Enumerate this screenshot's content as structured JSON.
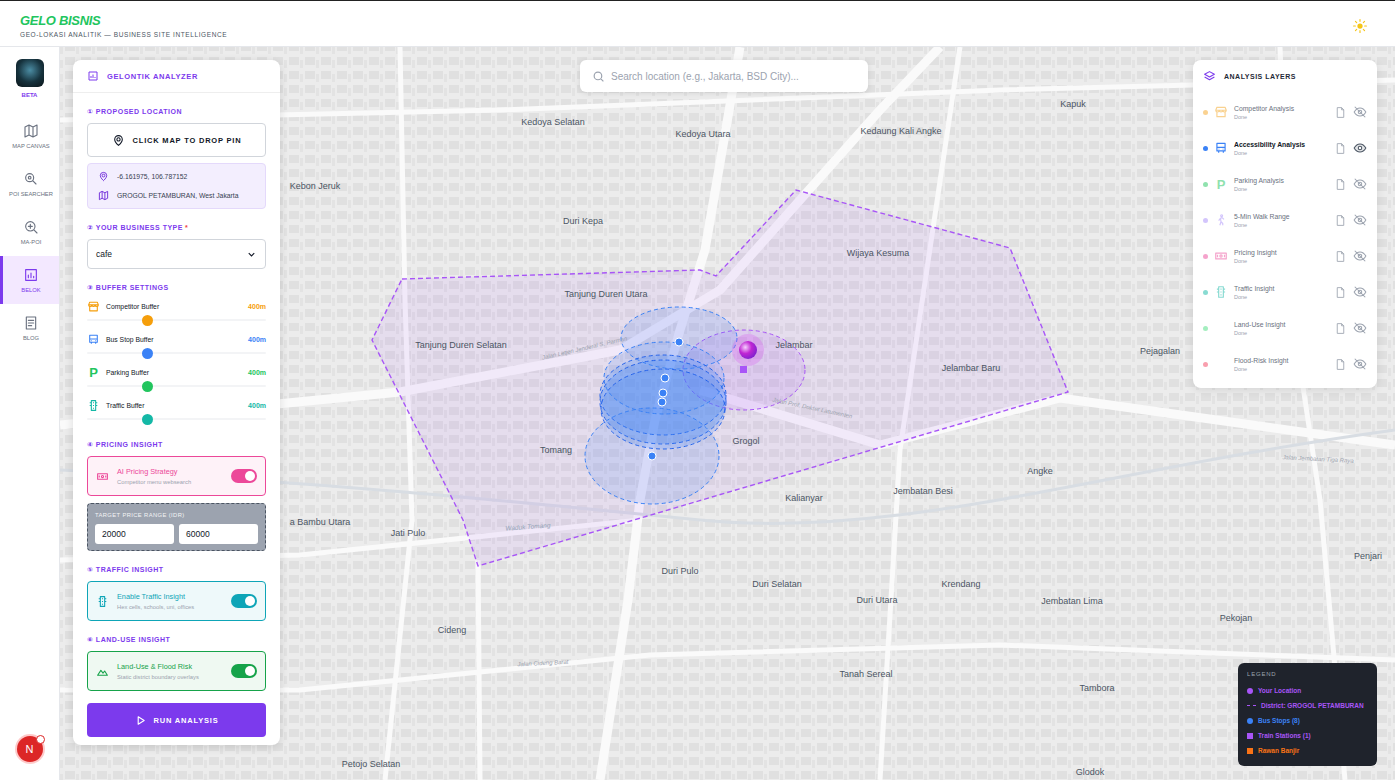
{
  "header": {
    "title": "GELO BISNIS",
    "subtitle": "GEO-LOKASI ANALITIK — BUSINESS SITE INTELLIGENCE"
  },
  "rail": {
    "badge": "BETA",
    "items": [
      {
        "label": "MAP CANVAS",
        "selected": false
      },
      {
        "label": "POI SEARCHER",
        "selected": false
      },
      {
        "label": "MA-POI",
        "selected": false
      },
      {
        "label": "BELOK",
        "selected": true
      },
      {
        "label": "BLOG",
        "selected": false
      }
    ],
    "user": "N"
  },
  "analyzer": {
    "title": "GELONTIK ANALYZER",
    "location": {
      "heading": "① PROPOSED LOCATION",
      "button": "CLICK MAP TO DROP PIN",
      "coords": "-6.161975, 106.787152",
      "district": "GROGOL PETAMBURAN, West Jakarta"
    },
    "business": {
      "heading": "② YOUR BUSINESS TYPE",
      "required": "*",
      "value": "cafe"
    },
    "buffers": {
      "heading": "③ BUFFER SETTINGS",
      "items": [
        {
          "label": "Competitor Buffer",
          "value": "400m",
          "level": 0.34,
          "color": "#f59e0b"
        },
        {
          "label": "Bus Stop Buffer",
          "value": "400m",
          "level": 0.34,
          "color": "#3b82f6"
        },
        {
          "label": "Parking Buffer",
          "value": "400m",
          "level": 0.34,
          "color": "#22c55e",
          "icon_text": "P"
        },
        {
          "label": "Traffic Buffer",
          "value": "400m",
          "level": 0.34,
          "color": "#14b8a6"
        }
      ]
    },
    "insights": [
      {
        "heading": "④ PRICING INSIGHT",
        "title": "AI Pricing Strategy",
        "subtitle": "Competitor menu websearch",
        "on": true,
        "color": "#ec4899",
        "range": {
          "label": "TARGET PRICE RANGE (IDR)",
          "min": "20000",
          "max": "60000"
        }
      },
      {
        "heading": "⑤ TRAFFIC INSIGHT",
        "title": "Enable Traffic Insight",
        "subtitle": "Hex cells, schools, uni, offices",
        "on": true,
        "color": "#0ea5b7"
      },
      {
        "heading": "⑥ LAND-USE INSIGHT",
        "title": "Land-Use & Flood Risk",
        "subtitle": "Static district boundary overlays",
        "on": true,
        "color": "#16a34a"
      }
    ],
    "run": "RUN ANALYSIS"
  },
  "search": {
    "placeholder": "Search location (e.g., Jakarta, BSD City)..."
  },
  "layers": {
    "title": "ANALYSIS LAYERS",
    "items": [
      {
        "name": "Competitor Analysis",
        "status": "Done",
        "color": "#f5a623",
        "visible": false,
        "selected": false
      },
      {
        "name": "Accessibility Analysis",
        "status": "Done",
        "color": "#3b82f6",
        "visible": true,
        "selected": true
      },
      {
        "name": "Parking Analysis",
        "status": "Done",
        "color": "#22c55e",
        "visible": false,
        "selected": false,
        "icon_text": "P"
      },
      {
        "name": "5-Min Walk Range",
        "status": "Done",
        "color": "#a78bfa",
        "visible": false,
        "selected": false
      },
      {
        "name": "Pricing Insight",
        "status": "Done",
        "color": "#ec4899",
        "visible": false,
        "selected": false
      },
      {
        "name": "Traffic Insight",
        "status": "Done",
        "color": "#14b8a6",
        "visible": false,
        "selected": false
      },
      {
        "name": "Land-Use Insight",
        "status": "Done",
        "color": "#4ade80",
        "visible": false,
        "selected": false
      },
      {
        "name": "Flood-Risk Insight",
        "status": "Done",
        "color": "#f43f5e",
        "visible": false,
        "selected": false
      }
    ]
  },
  "legend": {
    "title": "LEGEND",
    "items": [
      {
        "label": "Your Location",
        "kind": "dot",
        "color": "#a855f7"
      },
      {
        "label": "District: GROGOL PETAMBURAN",
        "kind": "dash",
        "color": "#a855f7"
      },
      {
        "label": "Bus Stops (8)",
        "kind": "dot",
        "color": "#3b82f6"
      },
      {
        "label": "Train Stations (1)",
        "kind": "square",
        "color": "#a855f7"
      },
      {
        "label": "Rawan Banjir",
        "kind": "square",
        "color": "#f97316"
      }
    ]
  },
  "map": {
    "labels": [
      {
        "text": "Kapuk",
        "kind": "place"
      },
      {
        "text": "Kedoya Selatan",
        "kind": "place"
      },
      {
        "text": "Kedoya Utara",
        "kind": "place"
      },
      {
        "text": "Kedaung Kali Angke",
        "kind": "place"
      },
      {
        "text": "Kebon Jeruk",
        "kind": "place"
      },
      {
        "text": "Duri Kepa",
        "kind": "place"
      },
      {
        "text": "Wijaya Kesuma",
        "kind": "place"
      },
      {
        "text": "Tanjung Duren Utara",
        "kind": "place"
      },
      {
        "text": "Tanjung Duren Selatan",
        "kind": "place"
      },
      {
        "text": "Jelambar",
        "kind": "place"
      },
      {
        "text": "Jelambar Baru",
        "kind": "place"
      },
      {
        "text": "Pejagalan",
        "kind": "place"
      },
      {
        "text": "Tomang",
        "kind": "place"
      },
      {
        "text": "Grogol",
        "kind": "place"
      },
      {
        "text": "Kalianyar",
        "kind": "place"
      },
      {
        "text": "Jembatan Besi",
        "kind": "place"
      },
      {
        "text": "Angke",
        "kind": "place"
      },
      {
        "text": "a Bambu Utara",
        "kind": "place"
      },
      {
        "text": "Jati Pulo",
        "kind": "place"
      },
      {
        "text": "Duri Pulo",
        "kind": "place"
      },
      {
        "text": "Duri Selatan",
        "kind": "place"
      },
      {
        "text": "Duri Utara",
        "kind": "place"
      },
      {
        "text": "Krendang",
        "kind": "place"
      },
      {
        "text": "Jembatan Lima",
        "kind": "place"
      },
      {
        "text": "Pekojan",
        "kind": "place"
      },
      {
        "text": "Penjari",
        "kind": "place"
      },
      {
        "text": "Cideng",
        "kind": "place"
      },
      {
        "text": "Tanah Sereal",
        "kind": "place"
      },
      {
        "text": "Tambora",
        "kind": "place"
      },
      {
        "text": "Petojo Selatan",
        "kind": "place"
      },
      {
        "text": "Glodok",
        "kind": "place"
      },
      {
        "text": "Jalan Letjen Jenderal S. Parman",
        "kind": "road"
      },
      {
        "text": "Jalan Prof. Dokter Latumenten",
        "kind": "road"
      },
      {
        "text": "Jalan Cideng Barat",
        "kind": "road"
      },
      {
        "text": "Jalan Jembatan Tiga Raya",
        "kind": "road"
      },
      {
        "text": "Waduk Tomang",
        "kind": "water"
      }
    ]
  }
}
